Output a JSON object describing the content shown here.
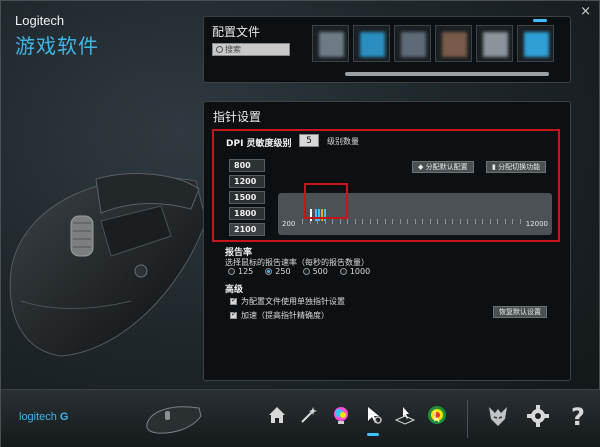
{
  "app": {
    "brand": "Logitech",
    "name": "游戏软件",
    "close": "×"
  },
  "profiles": {
    "title": "配置文件",
    "search_placeholder": "搜索",
    "slots": [
      {
        "icon": "profile-slot-1",
        "color": "#6e7b86"
      },
      {
        "icon": "profile-slot-2",
        "color": "#2a8fc0"
      },
      {
        "icon": "profile-slot-3",
        "color": "#5f6a78"
      },
      {
        "icon": "profile-slot-4",
        "color": "#7a5a4a"
      },
      {
        "icon": "profile-slot-5",
        "color": "#8a949a"
      },
      {
        "icon": "profile-slot-6",
        "color": "#2f9fd6"
      }
    ]
  },
  "pointer": {
    "title": "指针设置",
    "dpi": {
      "label": "DPI 灵敏度级别",
      "count": "5",
      "count_label": "级别数量",
      "assign_button": "分配默认配置",
      "shift_button": "分配切换功能",
      "levels": [
        "800",
        "1200",
        "1500",
        "1800",
        "2100"
      ],
      "slider_min": "200",
      "slider_max": "12000"
    },
    "report_rate": {
      "title": "报告率",
      "desc": "选择鼠标的报告速率（每秒的报告数量）",
      "options": [
        "125",
        "250",
        "500",
        "1000"
      ],
      "selected": "250"
    },
    "advanced": {
      "title": "高级",
      "option_1": "为配置文件使用单独指针设置",
      "option_2": "加速（提高指针精确度）",
      "restore_button": "恢复默认设置"
    }
  },
  "footer": {
    "logo": "logitech",
    "accent": "#3fc1ff"
  }
}
